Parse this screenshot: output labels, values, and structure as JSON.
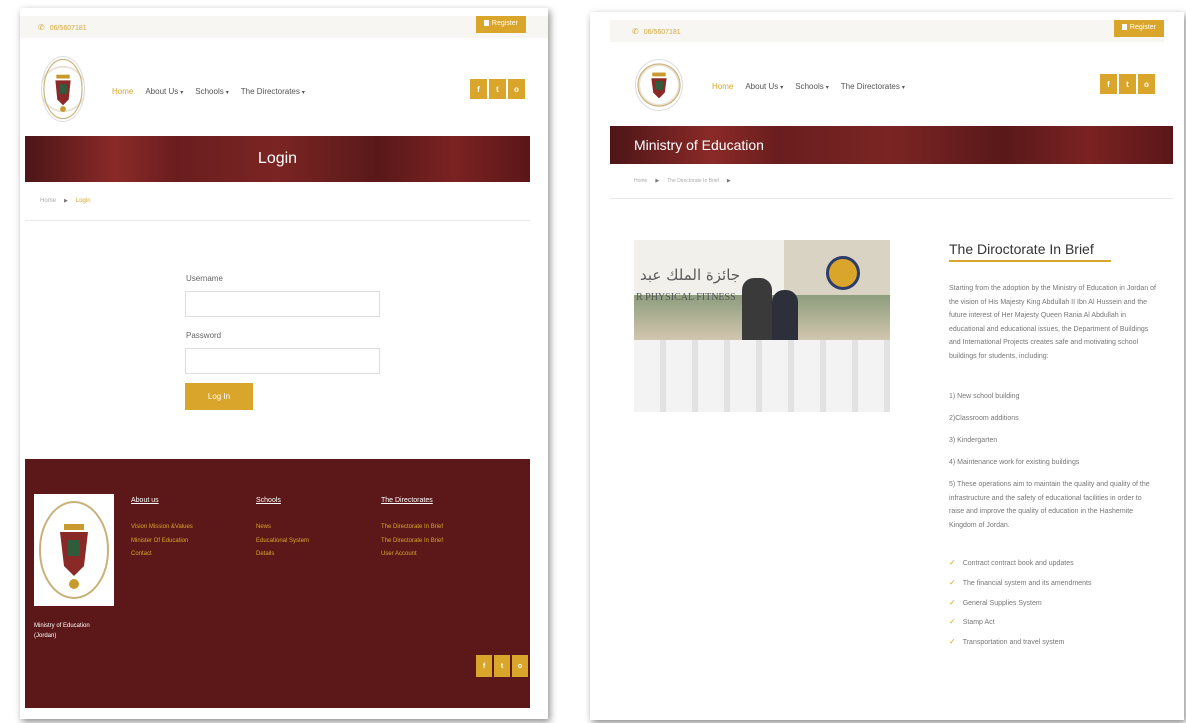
{
  "left": {
    "phone": "06/5607181",
    "register_label": "Register",
    "nav": [
      {
        "label": "Home",
        "active": true,
        "dropdown": false
      },
      {
        "label": "About Us",
        "active": false,
        "dropdown": true
      },
      {
        "label": "Schools",
        "active": false,
        "dropdown": true
      },
      {
        "label": "The Directorates",
        "active": false,
        "dropdown": true
      }
    ],
    "social": [
      "f",
      "t",
      "o"
    ],
    "banner_title": "Login",
    "breadcrumb": {
      "home": "Home",
      "current": "Login"
    },
    "form": {
      "username_label": "Username",
      "username_value": "",
      "password_label": "Password",
      "password_value": "",
      "submit_label": "Log In"
    },
    "footer": {
      "columns": [
        {
          "title": "About us",
          "links": [
            "Vision Mission &Values",
            "Minister Of Education",
            "Contact"
          ]
        },
        {
          "title": "Schools",
          "links": [
            "News",
            "Educational System",
            "Details"
          ]
        },
        {
          "title": "The Directorates",
          "links": [
            "The Directorate In Brief",
            "The Directorate In Brief",
            "User Account"
          ]
        }
      ],
      "org_line1": "Ministry of Education",
      "org_line2": "(Jordan)"
    }
  },
  "right": {
    "phone": "06/5607181",
    "register_label": "Register",
    "nav": [
      {
        "label": "Home",
        "active": true,
        "dropdown": false
      },
      {
        "label": "About Us",
        "active": false,
        "dropdown": true
      },
      {
        "label": "Schools",
        "active": false,
        "dropdown": true
      },
      {
        "label": "The Directorates",
        "active": false,
        "dropdown": true
      }
    ],
    "social": [
      "f",
      "t",
      "o"
    ],
    "banner_title": "Ministry of Education",
    "breadcrumb": {
      "home": "Home",
      "current": "The Directorate In Brief"
    },
    "photo": {
      "arabic_sign": "جائزة الملك عبد",
      "english_sign": "R PHYSICAL FITNESS"
    },
    "article": {
      "title": "The Diroctorate In Brief",
      "intro": "Starting from the adoption by the Ministry of Education in Jordan of the vision of His Majesty King Abdullah II Ibn Al Hussein and the future interest of Her Majesty Queen Rania Al Abdullah in educational and educational issues, the Department of Buildings and International Projects creates safe and motivating school buildings for students, including:",
      "items": [
        "1) New school building",
        "2)Classroom additions",
        "3) Kindergarten",
        "4) Maintenance work for existing buildings"
      ],
      "item5": "5) These operations aim to maintain the quality and quality of the infrastructure and the safety of educational facilities in order to raise and improve the quality of education in the Hashemite Kingdom of Jordan.",
      "checklist": [
        "Contract contract book and updates",
        "The financial system and its amendments",
        "General Supplies System",
        "Stamp Act",
        "Transportation and travel system"
      ]
    }
  },
  "colors": {
    "accent": "#d9a52b",
    "banner": "#6a1d1e",
    "footer": "#5c1818"
  }
}
